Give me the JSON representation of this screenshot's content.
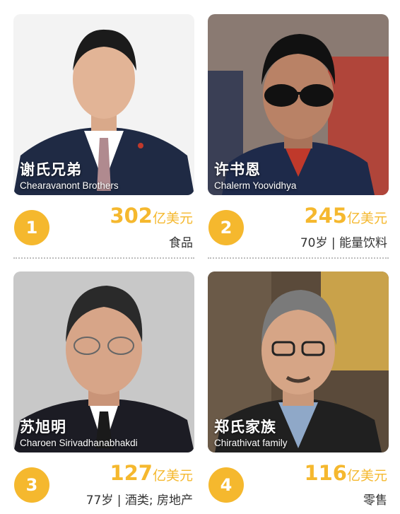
{
  "people": [
    {
      "rank": "1",
      "name_cn": "谢氏兄弟",
      "name_en": "Chearavanont Brothers",
      "worth_number": "302",
      "worth_unit": "亿美元",
      "meta": "食品"
    },
    {
      "rank": "2",
      "name_cn": "许书恩",
      "name_en": "Chalerm Yoovidhya",
      "worth_number": "245",
      "worth_unit": "亿美元",
      "meta": "70岁 | 能量饮料"
    },
    {
      "rank": "3",
      "name_cn": "苏旭明",
      "name_en": "Charoen Sirivadhanabhakdi",
      "worth_number": "127",
      "worth_unit": "亿美元",
      "meta": "77岁 | 酒类; 房地产"
    },
    {
      "rank": "4",
      "name_cn": "郑氏家族",
      "name_en": "Chirathivat family",
      "worth_number": "116",
      "worth_unit": "亿美元",
      "meta": "零售"
    }
  ],
  "colors": {
    "accent": "#f5b82e",
    "text": "#333333",
    "divider": "#bdbdbd"
  }
}
